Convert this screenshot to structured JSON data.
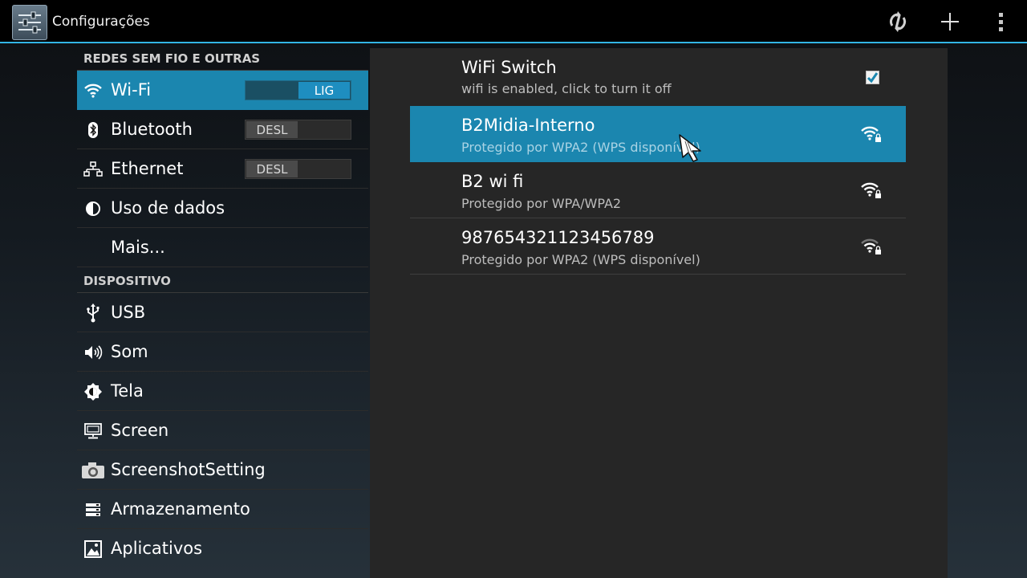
{
  "app": {
    "title": "Configurações",
    "icon": "settings-icon"
  },
  "actionbar": {
    "buttons": [
      {
        "icon": "wps-icon"
      },
      {
        "icon": "add-icon"
      },
      {
        "icon": "overflow-menu-icon"
      }
    ]
  },
  "sidebar": {
    "section_wireless": "REDES SEM FIO E OUTRAS",
    "section_device": "DISPOSITIVO",
    "wifi": {
      "label": "Wi-Fi",
      "toggle": "LIG",
      "icon": "wifi-icon"
    },
    "bluetooth": {
      "label": "Bluetooth",
      "toggle": "DESL",
      "icon": "bluetooth-icon"
    },
    "ethernet": {
      "label": "Ethernet",
      "toggle": "DESL",
      "icon": "ethernet-icon"
    },
    "data_usage": {
      "label": "Uso de dados",
      "icon": "data-usage-icon"
    },
    "more": {
      "label": "Mais..."
    },
    "usb": {
      "label": "USB",
      "icon": "usb-icon"
    },
    "sound": {
      "label": "Som",
      "icon": "sound-icon"
    },
    "display": {
      "label": "Tela",
      "icon": "brightness-icon"
    },
    "screen": {
      "label": "Screen",
      "icon": "monitor-icon"
    },
    "screenshot": {
      "label": "ScreenshotSetting",
      "icon": "camera-icon"
    },
    "storage": {
      "label": "Armazenamento",
      "icon": "storage-icon"
    },
    "apps": {
      "label": "Aplicativos",
      "icon": "apps-icon"
    }
  },
  "wifi_panel": {
    "switch_title": "WiFi Switch",
    "switch_subtitle": "wifi is enabled, click to turn it off",
    "switch_checked": true,
    "networks": [
      {
        "name": "B2Midia-Interno",
        "security": "Protegido por WPA2 (WPS disponível)",
        "selected": true
      },
      {
        "name": "B2 wi fi",
        "security": "Protegido por WPA/WPA2"
      },
      {
        "name": "987654321123456789",
        "security": "Protegido por WPA2 (WPS disponível)"
      }
    ]
  },
  "colors": {
    "accent": "#33b5e5",
    "selection": "#1b86af"
  }
}
